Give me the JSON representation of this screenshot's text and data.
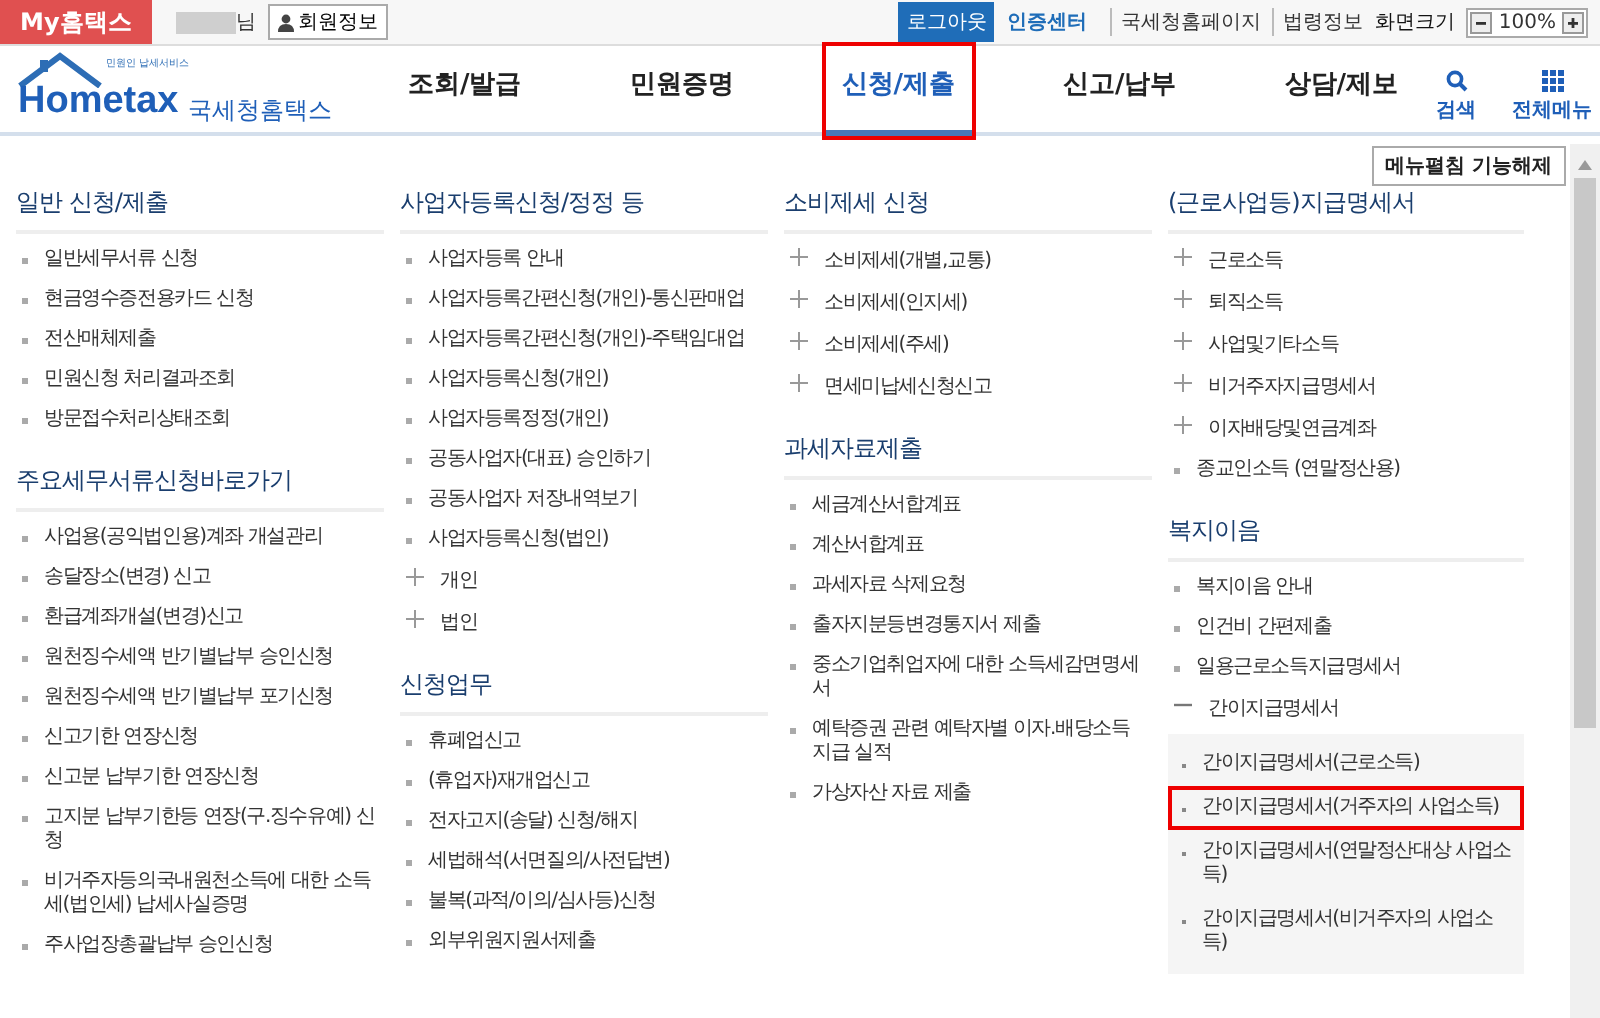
{
  "topbar": {
    "brand": "My홈택스",
    "user_suffix": "님",
    "member_button": "회원정보",
    "logout": "로그아웃",
    "cert_center": "인증센터",
    "links": [
      "국세청홈페이지",
      "법령정보"
    ],
    "zoom_label": "화면크기",
    "zoom_value": "100%"
  },
  "header": {
    "logo_small": "민원인 납세서비스",
    "logo_text": "Hometax",
    "logo_name": "국세청홈택스",
    "nav": [
      {
        "label": "조회/발급",
        "selected": false,
        "highlighted": false
      },
      {
        "label": "민원증명",
        "selected": false,
        "highlighted": false
      },
      {
        "label": "신청/제출",
        "selected": true,
        "highlighted": true
      },
      {
        "label": "신고/납부",
        "selected": false,
        "highlighted": false
      },
      {
        "label": "상담/제보",
        "selected": false,
        "highlighted": false
      }
    ],
    "search": "검색",
    "all_menu": "전체메뉴"
  },
  "menu_toggle": "메뉴펼침 기능해제",
  "columns": [
    [
      {
        "title": "일반 신청/제출",
        "items": [
          {
            "kind": "bullet",
            "label": "일반세무서류 신청"
          },
          {
            "kind": "bullet",
            "label": "현금영수증전용카드 신청"
          },
          {
            "kind": "bullet",
            "label": "전산매체제출"
          },
          {
            "kind": "bullet",
            "label": "민원신청 처리결과조회"
          },
          {
            "kind": "bullet",
            "label": "방문접수처리상태조회"
          }
        ]
      },
      {
        "title": "주요세무서류신청바로가기",
        "items": [
          {
            "kind": "bullet",
            "label": "사업용(공익법인용)계좌 개설관리"
          },
          {
            "kind": "bullet",
            "label": "송달장소(변경) 신고"
          },
          {
            "kind": "bullet",
            "label": "환급계좌개설(변경)신고"
          },
          {
            "kind": "bullet",
            "label": "원천징수세액 반기별납부 승인신청"
          },
          {
            "kind": "bullet",
            "label": "원천징수세액 반기별납부 포기신청"
          },
          {
            "kind": "bullet",
            "label": "신고기한 연장신청"
          },
          {
            "kind": "bullet",
            "label": "신고분 납부기한 연장신청"
          },
          {
            "kind": "bullet",
            "label": "고지분 납부기한등 연장(구.징수유예) 신청"
          },
          {
            "kind": "bullet",
            "label": "비거주자등의국내원천소득에 대한 소득세(법인세) 납세사실증명"
          },
          {
            "kind": "bullet",
            "label": "주사업장총괄납부 승인신청"
          }
        ]
      }
    ],
    [
      {
        "title": "사업자등록신청/정정 등",
        "items": [
          {
            "kind": "bullet",
            "label": "사업자등록 안내"
          },
          {
            "kind": "bullet",
            "label": "사업자등록간편신청(개인)-통신판매업"
          },
          {
            "kind": "bullet",
            "label": "사업자등록간편신청(개인)-주택임대업"
          },
          {
            "kind": "bullet",
            "label": "사업자등록신청(개인)"
          },
          {
            "kind": "bullet",
            "label": "사업자등록정정(개인)"
          },
          {
            "kind": "bullet",
            "label": "공동사업자(대표) 승인하기"
          },
          {
            "kind": "bullet",
            "label": "공동사업자 저장내역보기"
          },
          {
            "kind": "bullet",
            "label": "사업자등록신청(법인)"
          },
          {
            "kind": "plus",
            "label": "개인"
          },
          {
            "kind": "plus",
            "label": "법인"
          }
        ]
      },
      {
        "title": "신청업무",
        "items": [
          {
            "kind": "bullet",
            "label": "휴폐업신고"
          },
          {
            "kind": "bullet",
            "label": "(휴업자)재개업신고"
          },
          {
            "kind": "bullet",
            "label": "전자고지(송달) 신청/해지"
          },
          {
            "kind": "bullet",
            "label": "세법해석(서면질의/사전답변)"
          },
          {
            "kind": "bullet",
            "label": "불복(과적/이의/심사등)신청"
          },
          {
            "kind": "bullet",
            "label": "외부위원지원서제출"
          }
        ]
      }
    ],
    [
      {
        "title": "소비제세 신청",
        "items": [
          {
            "kind": "plus",
            "label": "소비제세(개별,교통)"
          },
          {
            "kind": "plus",
            "label": "소비제세(인지세)"
          },
          {
            "kind": "plus",
            "label": "소비제세(주세)"
          },
          {
            "kind": "plus",
            "label": "면세미납세신청신고"
          }
        ]
      },
      {
        "title": "과세자료제출",
        "items": [
          {
            "kind": "bullet",
            "label": "세금계산서합계표"
          },
          {
            "kind": "bullet",
            "label": "계산서합계표"
          },
          {
            "kind": "bullet",
            "label": "과세자료 삭제요청"
          },
          {
            "kind": "bullet",
            "label": "출자지분등변경통지서 제출"
          },
          {
            "kind": "bullet",
            "label": "중소기업취업자에 대한 소득세감면명세서"
          },
          {
            "kind": "bullet",
            "label": "예탁증권 관련 예탁자별 이자.배당소득 지급 실적"
          },
          {
            "kind": "bullet",
            "label": "가상자산 자료 제출"
          }
        ]
      }
    ],
    [
      {
        "title": "(근로사업등)지급명세서",
        "items": [
          {
            "kind": "plus",
            "label": "근로소득"
          },
          {
            "kind": "plus",
            "label": "퇴직소득"
          },
          {
            "kind": "plus",
            "label": "사업및기타소득"
          },
          {
            "kind": "plus",
            "label": "비거주자지급명세서"
          },
          {
            "kind": "plus",
            "label": "이자배당및연금계좌"
          },
          {
            "kind": "bullet",
            "label": "종교인소득 (연말정산용)"
          }
        ]
      },
      {
        "title": "복지이음",
        "items": [
          {
            "kind": "bullet",
            "label": "복지이음 안내"
          },
          {
            "kind": "bullet",
            "label": "인건비 간편제출"
          },
          {
            "kind": "bullet",
            "label": "일용근로소득지급명세서"
          },
          {
            "kind": "minus",
            "label": "간이지급명세서",
            "children": [
              {
                "label": "간이지급명세서(근로소득)",
                "highlighted": false
              },
              {
                "label": "간이지급명세서(거주자의 사업소득)",
                "highlighted": true
              },
              {
                "label": "간이지급명세서(연말정산대상 사업소득)",
                "highlighted": false
              },
              {
                "label": "간이지급명세서(비거주자의 사업소득)",
                "highlighted": false
              }
            ]
          }
        ]
      }
    ]
  ]
}
